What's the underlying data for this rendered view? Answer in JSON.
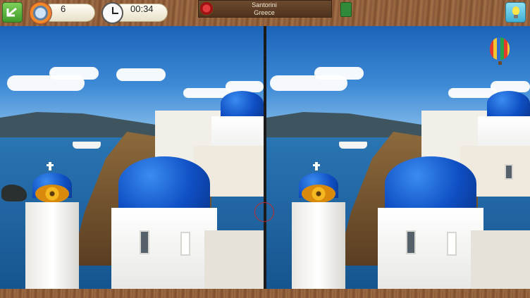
{
  "toolbar": {
    "back_icon": "back-arrow-icon",
    "hint_icon": "hint-ring-icon",
    "hints_count": "6",
    "timer_icon": "clock-icon",
    "timer_value": "00:34",
    "scene_title": "Santorini",
    "scene_subtitle": "Greece",
    "scene_icon": "rose-icon",
    "journal_icon": "green-book-icon",
    "tip_icon": "lightbulb-icon"
  },
  "colors": {
    "accent_green": "#4caf34",
    "accent_cyan": "#3fb0d4",
    "wood": "#8a5a36",
    "marker_red": "#c0262a"
  },
  "scene": {
    "left_image": "santorini-original",
    "right_image": "santorini-modified",
    "extra_in_right": "hot-air-balloon"
  }
}
